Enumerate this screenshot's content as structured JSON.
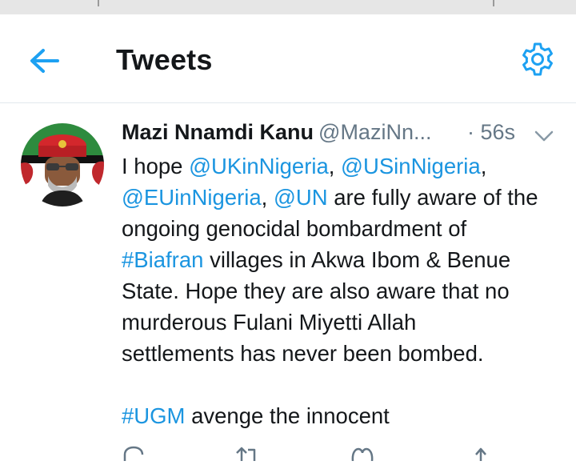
{
  "header": {
    "title": "Tweets",
    "back_icon": "back-arrow-icon",
    "settings_icon": "gear-icon",
    "accent": "#1da1f2"
  },
  "tweet": {
    "display_name": "Mazi Nnamdi Kanu",
    "handle": "@MaziNn...",
    "timestamp": "· 56s",
    "body_line1_pre": "I hope ",
    "mention_uk": "@UKinNigeria",
    "comma1": ", ",
    "mention_us": "@USinNigeria",
    "comma2": ",",
    "mention_eu": "@EUinNigeria",
    "comma3": ", ",
    "mention_un": "@UN",
    "text_after_un": " are fully aware of the",
    "line3": "ongoing genocidal bombardment of",
    "hashtag_biafran": "#Biafran",
    "text_after_biafran": " villages in Akwa Ibom & Benue",
    "line5": "State. Hope they are also aware that no",
    "line6": "murderous Fulani Miyetti Allah",
    "line7": "settlements has never been bombed.",
    "hashtag_ugm": "#UGM",
    "text_after_ugm": " avenge the innocent",
    "link_color": "#1b95e0",
    "muted_color": "#657786"
  },
  "actions": [
    "reply-icon",
    "retweet-icon",
    "like-icon",
    "share-icon"
  ]
}
